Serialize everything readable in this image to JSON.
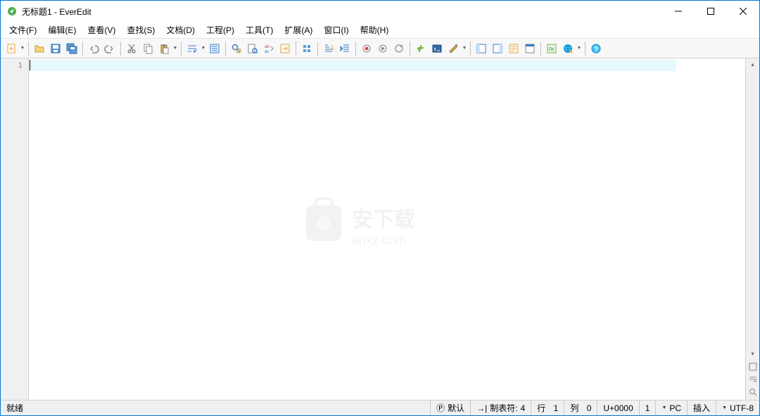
{
  "title": "无标题1 - EverEdit",
  "menu": {
    "file": "文件(F)",
    "edit": "编辑(E)",
    "view": "查看(V)",
    "search": "查找(S)",
    "document": "文档(D)",
    "project": "工程(P)",
    "tools": "工具(T)",
    "addons": "扩展(A)",
    "window": "窗口(I)",
    "help": "帮助(H)"
  },
  "gutter": {
    "line1": "1"
  },
  "status": {
    "ready": "就绪",
    "printmode": "默认",
    "tabstop_label": "制表符:",
    "tabstop_value": "4",
    "line_label": "行",
    "line_value": "1",
    "col_label": "列",
    "col_value": "0",
    "unicode": "U+0000",
    "page": "1",
    "lineend": "PC",
    "insert": "插入",
    "encoding": "UTF-8"
  },
  "watermark": {
    "text": "安下载",
    "sub": "anxz.com"
  }
}
